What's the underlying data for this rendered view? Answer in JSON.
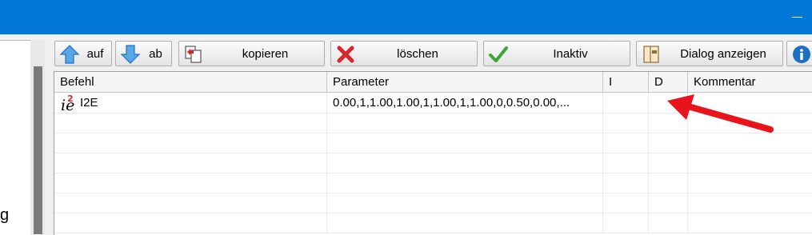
{
  "window": {
    "accent": "#0078d7"
  },
  "left_panel": {
    "partial_text": "g"
  },
  "toolbar": {
    "up_label": "auf",
    "down_label": "ab",
    "copy_label": "kopieren",
    "delete_label": "löschen",
    "inactive_label": "Inaktiv",
    "dialog_label": "Dialog anzeigen"
  },
  "table": {
    "columns": [
      "Befehl",
      "Parameter",
      "I",
      "D",
      "Kommentar"
    ],
    "rows": [
      {
        "befehl": "I2E",
        "parameter": "0.00,1,1.00,1.00,1,1.00,1,1.00,0,0.50,0.00,...",
        "i": "",
        "d": "",
        "kommentar": ""
      }
    ]
  },
  "annotation": {
    "color": "#e8141c"
  }
}
